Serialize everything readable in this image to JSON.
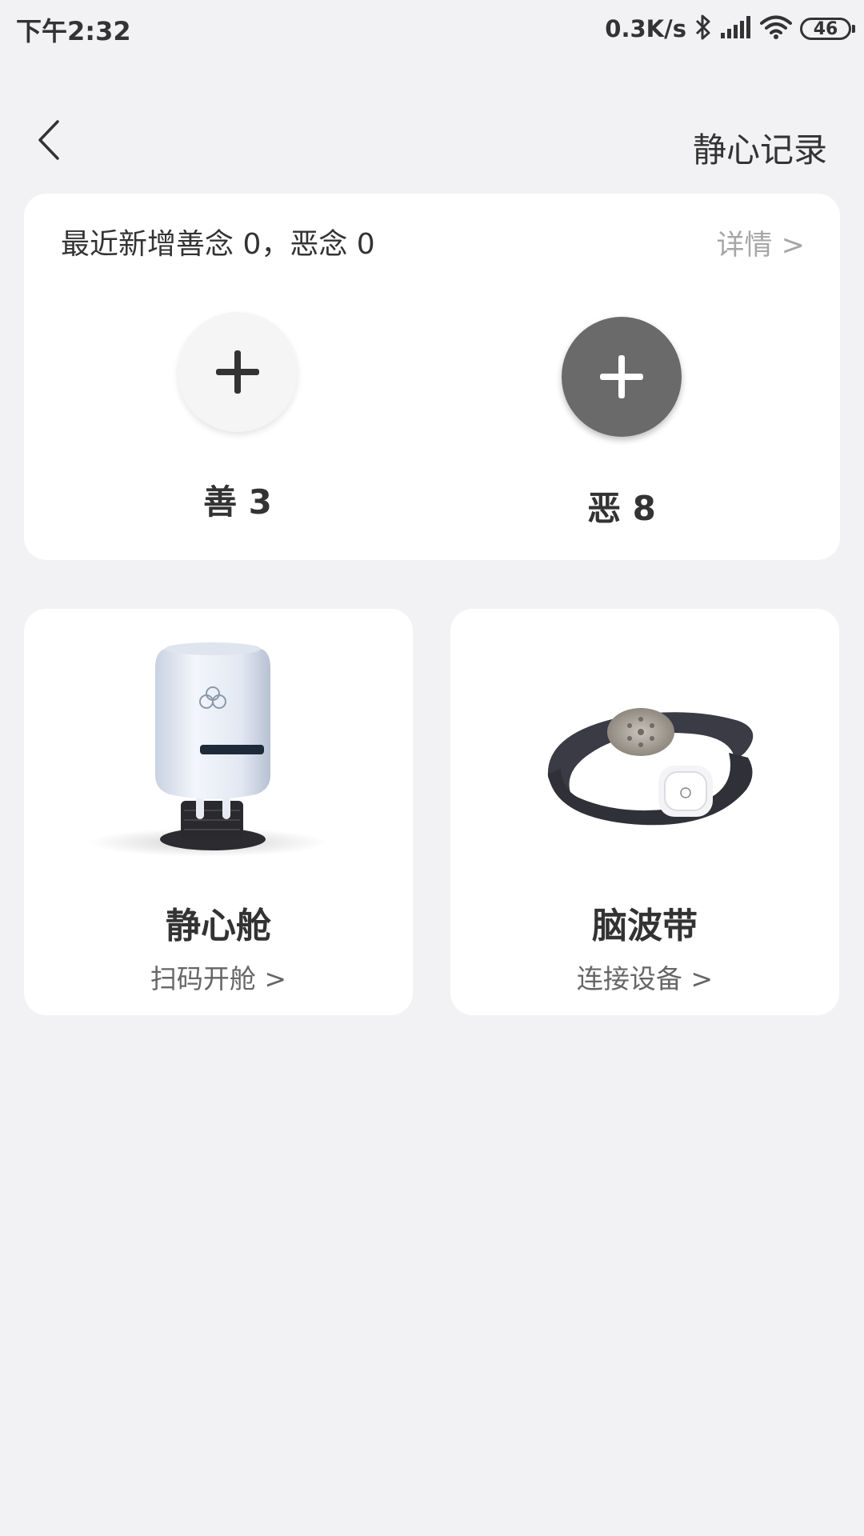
{
  "status_bar": {
    "time": "下午2:32",
    "net_speed": "0.3K/s",
    "battery": "46",
    "icons": [
      "bluetooth-icon",
      "signal-icon",
      "wifi-icon",
      "battery-icon"
    ]
  },
  "header": {
    "back_icon": "chevron-left-icon",
    "title": "静心记录"
  },
  "summary": {
    "text": "最近新增善念 0，恶念 0",
    "detail_label": "详情 >",
    "good": {
      "icon": "plus-icon",
      "label": "善 3"
    },
    "bad": {
      "icon": "plus-icon",
      "label": "恶 8"
    }
  },
  "devices": [
    {
      "name": "静心舱",
      "action": "扫码开舱 >",
      "icon": "pod-device-image"
    },
    {
      "name": "脑波带",
      "action": "连接设备 >",
      "icon": "headband-device-image"
    }
  ],
  "colors": {
    "background": "#f2f2f5",
    "card": "#ffffff",
    "text_primary": "#333333",
    "text_secondary": "#666666",
    "text_muted": "#a6a6a6",
    "bad_button": "#6a6a6a"
  }
}
